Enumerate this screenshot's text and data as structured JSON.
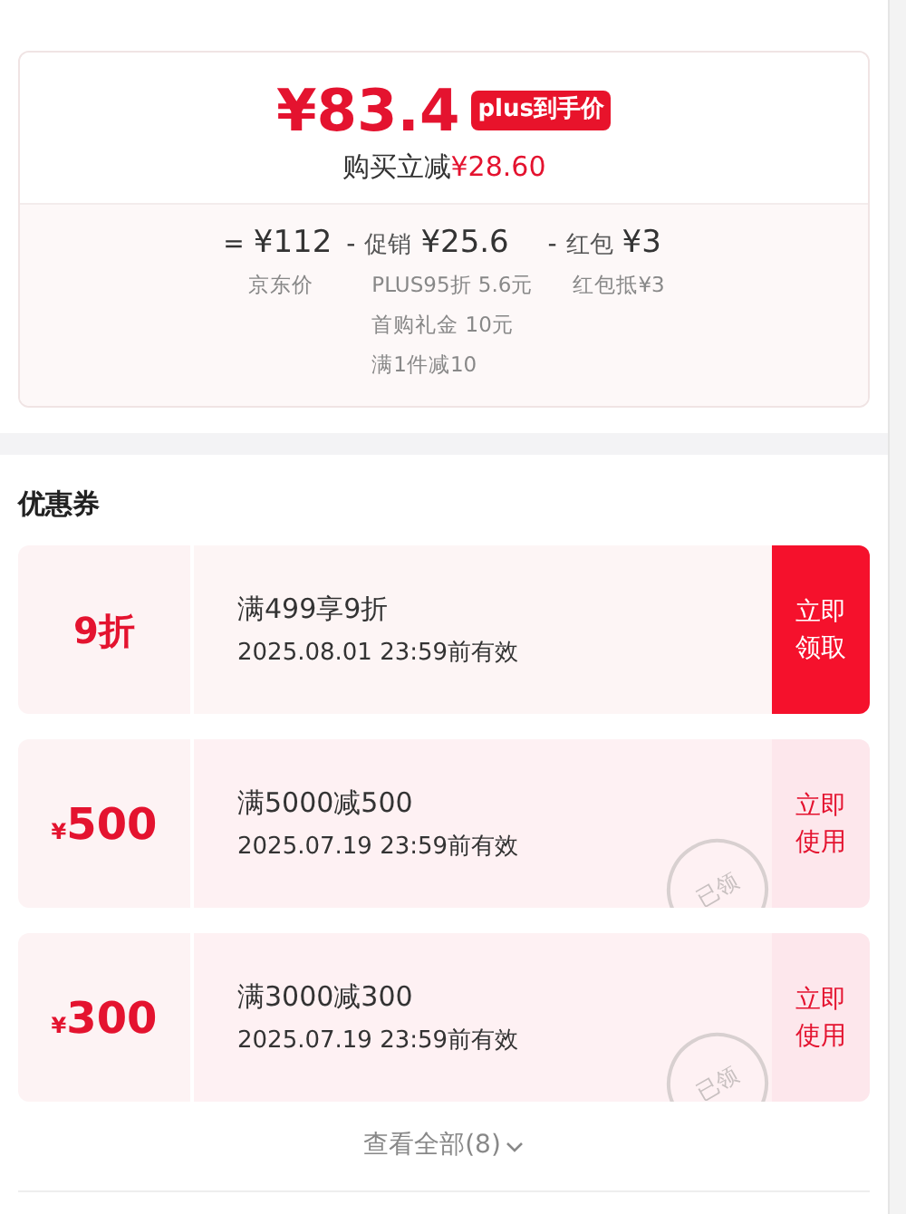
{
  "price_card": {
    "price": "¥83.4",
    "badge": "plus到手价",
    "saving_label": "购买立减",
    "saving_amount": "¥28.60",
    "breakdown": [
      {
        "operator": "=",
        "amount": "¥112",
        "notes": [
          "京东价"
        ]
      },
      {
        "operator": "-",
        "label": "促销",
        "amount": "¥25.6",
        "notes": [
          "PLUS95折 5.6元",
          "首购礼金 10元",
          "满1件减10"
        ]
      },
      {
        "operator": "-",
        "label": "红包",
        "amount": "¥3",
        "notes": [
          "红包抵¥3"
        ]
      }
    ]
  },
  "coupons_section": {
    "title": "优惠券",
    "coupons": [
      {
        "kind": "discount",
        "value": "9折",
        "title": "满499享9折",
        "expiry": "2025.08.01 23:59前有效",
        "action": "立即领取",
        "claimed": false
      },
      {
        "kind": "amount",
        "currency": "¥",
        "value": "500",
        "title": "满5000减500",
        "expiry": "2025.07.19 23:59前有效",
        "action": "立即使用",
        "claimed": true,
        "stamp": "已领"
      },
      {
        "kind": "amount",
        "currency": "¥",
        "value": "300",
        "title": "满3000减300",
        "expiry": "2025.07.19 23:59前有效",
        "action": "立即使用",
        "claimed": true,
        "stamp": "已领"
      }
    ],
    "view_all": "查看全部(8)"
  }
}
